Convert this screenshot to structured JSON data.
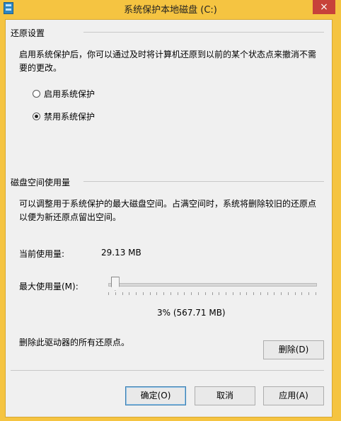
{
  "window": {
    "title": "系统保护本地磁盘 (C:)",
    "close_glyph": "×"
  },
  "restore_settings": {
    "section_title": "还原设置",
    "description_line1": "启用系统保护后，你可以通过及时将计算机还原到以前的某个状态点来撤消不需",
    "description_line2": "要的更改。",
    "options": [
      {
        "label": "启用系统保护",
        "selected": false
      },
      {
        "label": "禁用系统保护",
        "selected": true
      }
    ]
  },
  "disk_usage": {
    "section_title": "磁盘空间使用量",
    "description_line1": "可以调整用于系统保护的最大磁盘空间。占满空间时，系统将删除较旧的还原点",
    "description_line2": "以便为新还原点留出空间。",
    "current_usage_label": "当前使用量:",
    "current_usage_value": "29.13 MB",
    "max_usage_label": "最大使用量(M):",
    "max_usage_fraction": 0.03,
    "max_usage_display": "3% (567.71 MB)"
  },
  "delete": {
    "description": "删除此驱动器的所有还原点。",
    "button_label": "删除(D)"
  },
  "footer": {
    "ok_label": "确定(O)",
    "cancel_label": "取消",
    "apply_label": "应用(A)"
  }
}
